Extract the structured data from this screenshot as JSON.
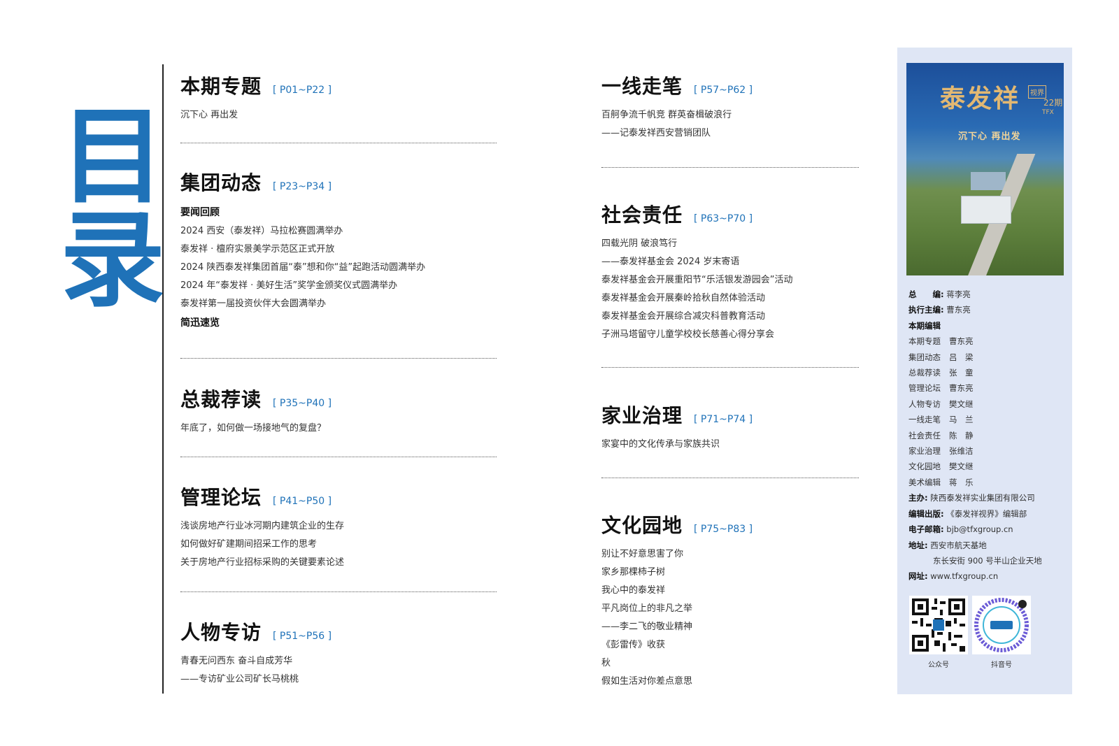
{
  "title_chars": [
    "目",
    "录"
  ],
  "left_column": [
    {
      "title": "本期专题",
      "pages": "[ P01~P22 ]",
      "lines": [
        "沉下心 再出发"
      ]
    },
    {
      "title": "集团动态",
      "pages": "[ P23~P34 ]",
      "subheads": [
        "要闻回顾",
        "简迅速览"
      ],
      "lines": [
        "2024 西安（泰发祥）马拉松赛圆满举办",
        "泰发祥 · 檀府实景美学示范区正式开放",
        "2024 陕西泰发祥集团首届“泰”想和你“益”起跑活动圆满举办",
        "2024 年“泰发祥 · 美好生活”奖学金颁奖仪式圆满举办",
        "泰发祥第一届投资伙伴大会圆满举办"
      ]
    },
    {
      "title": "总裁荐读",
      "pages": "[ P35~P40 ]",
      "lines": [
        "年底了，如何做一场接地气的复盘？"
      ]
    },
    {
      "title": "管理论坛",
      "pages": "[ P41~P50 ]",
      "lines": [
        "浅谈房地产行业冰河期内建筑企业的生存",
        "如何做好矿建期间招采工作的思考",
        "关于房地产行业招标采购的关键要素论述"
      ]
    },
    {
      "title": "人物专访",
      "pages": "[ P51~P56 ]",
      "lines": [
        "青春无问西东  奋斗自成芳华",
        "——专访矿业公司矿长马桃桃"
      ]
    }
  ],
  "right_column": [
    {
      "title": "一线走笔",
      "pages": "[ P57~P62 ]",
      "lines": [
        "百舸争流千帆竞 群英奋楫破浪行",
        "——记泰发祥西安营销团队"
      ]
    },
    {
      "title": "社会责任",
      "pages": "[ P63~P70 ]",
      "lines": [
        "四载光阴  破浪笃行",
        "——泰发祥基金会 2024 岁末寄语",
        "泰发祥基金会开展重阳节“乐活银发游园会”活动",
        "泰发祥基金会开展秦岭拾秋自然体验活动",
        "泰发祥基金会开展综合减灾科普教育活动",
        "子洲马塔留守儿童学校校长慈善心得分享会"
      ]
    },
    {
      "title": "家业治理",
      "pages": "[ P71~P74 ]",
      "lines": [
        "家宴中的文化传承与家族共识"
      ]
    },
    {
      "title": "文化园地",
      "pages": "[ P75~P83 ]",
      "lines": [
        "别让不好意思害了你",
        "家乡那棵柿子树",
        "我心中的泰发祥",
        "平凡岗位上的非凡之举",
        "——李二飞的敬业精神",
        "《彭雷传》收获",
        "秋",
        "假如生活对你差点意思"
      ]
    }
  ],
  "cover": {
    "title": "泰发祥",
    "badge": "视界",
    "issue": "22期",
    "tag": "TFX",
    "slogan": "沉下心 再出发"
  },
  "credits": {
    "chief_editor_label": "总　　编:",
    "chief_editor": "蒋李亮",
    "exec_editor_label": "执行主编:",
    "exec_editor": "曹东亮",
    "editors_label": "本期编辑",
    "editors": [
      {
        "dept": "本期专题",
        "name": "曹东亮"
      },
      {
        "dept": "集团动态",
        "name": "吕　梁"
      },
      {
        "dept": "总裁荐读",
        "name": "张　童"
      },
      {
        "dept": "管理论坛",
        "name": "曹东亮"
      },
      {
        "dept": "人物专访",
        "name": "樊文继"
      },
      {
        "dept": "一线走笔",
        "name": "马　兰"
      },
      {
        "dept": "社会责任",
        "name": "陈　静"
      },
      {
        "dept": "家业治理",
        "name": "张维洁"
      },
      {
        "dept": "文化园地",
        "name": "樊文继"
      },
      {
        "dept": "美术编辑",
        "name": "蒋　乐"
      }
    ],
    "host_label": "主办:",
    "host": "陕西泰发祥实业集团有限公司",
    "publish_label": "编辑出版:",
    "publish": "《泰发祥视界》编辑部",
    "email_label": "电子邮箱:",
    "email": "bjb@tfxgroup.cn",
    "address_label": "地址:",
    "address1": "西安市航天基地",
    "address2": "东长安街 900 号半山企业天地",
    "web_label": "网址:",
    "web": "www.tfxgroup.cn"
  },
  "qr": [
    {
      "label": "公众号"
    },
    {
      "label": "抖音号"
    }
  ],
  "colors": {
    "accent": "#1f72b8",
    "sidebar": "#dfe6f5"
  }
}
